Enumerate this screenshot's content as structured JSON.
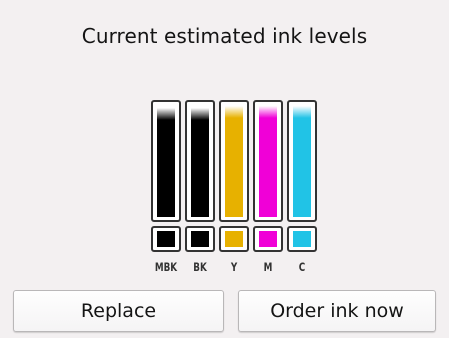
{
  "screen": {
    "title": "Current estimated ink levels"
  },
  "ink_levels": {
    "cartridges": [
      {
        "label": "MBK",
        "color": "#000000",
        "level": 0.88
      },
      {
        "label": "BK",
        "color": "#000000",
        "level": 0.88
      },
      {
        "label": "Y",
        "color": "#e7b100",
        "level": 0.9
      },
      {
        "label": "M",
        "color": "#f000d7",
        "level": 0.9
      },
      {
        "label": "C",
        "color": "#21c3e6",
        "level": 0.9
      }
    ]
  },
  "buttons": {
    "replace_label": "Replace",
    "order_label": "Order ink now"
  }
}
